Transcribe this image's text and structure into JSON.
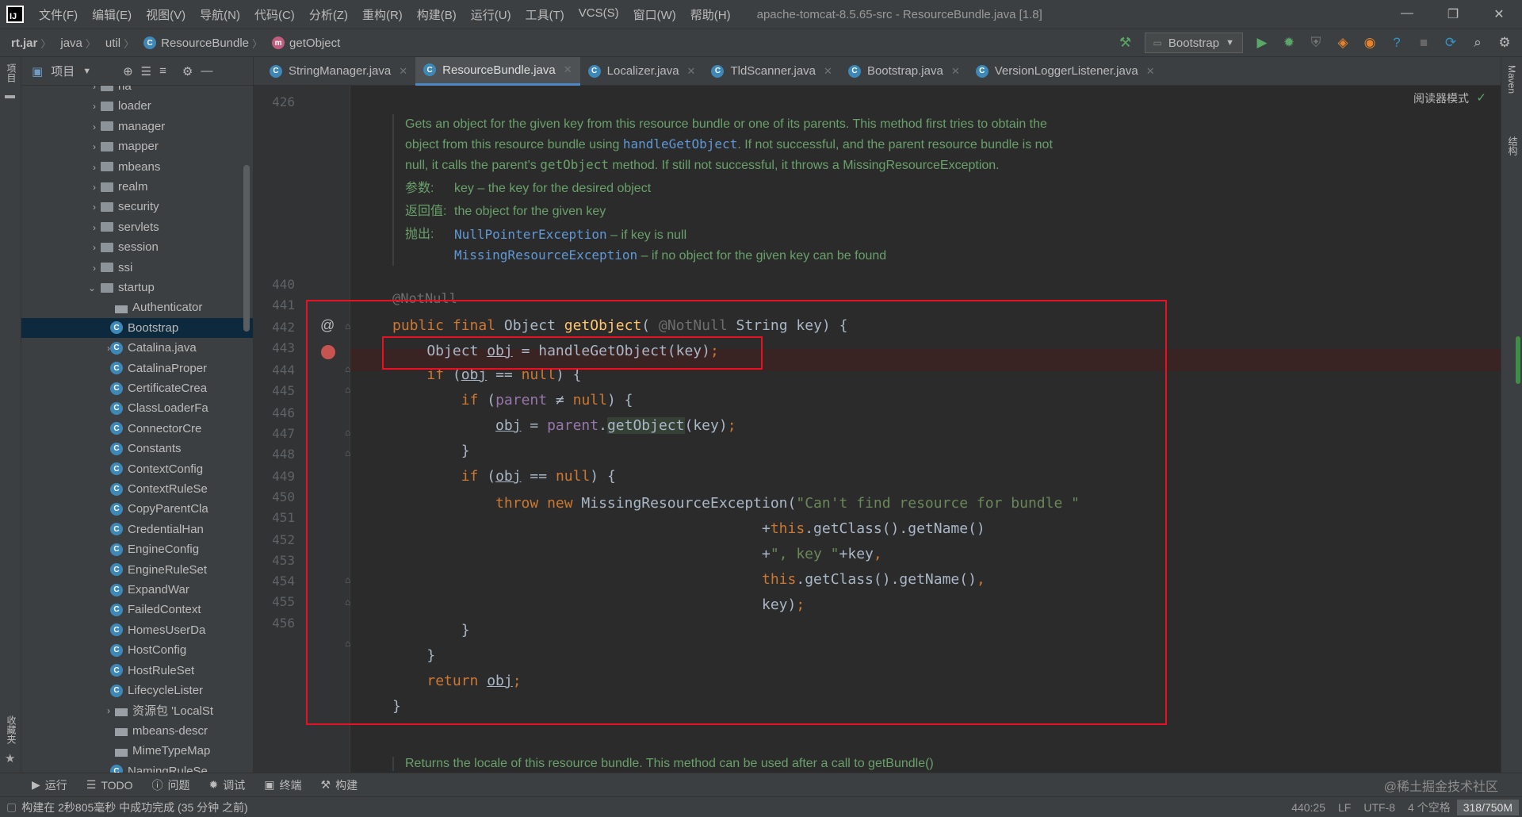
{
  "menubar": {
    "items": [
      "文件(F)",
      "编辑(E)",
      "视图(V)",
      "导航(N)",
      "代码(C)",
      "分析(Z)",
      "重构(R)",
      "构建(B)",
      "运行(U)",
      "工具(T)",
      "VCS(S)",
      "窗口(W)",
      "帮助(H)"
    ],
    "title": "apache-tomcat-8.5.65-src - ResourceBundle.java [1.8]"
  },
  "navbar": {
    "crumbs": [
      "rt.jar",
      "java",
      "util",
      "ResourceBundle",
      "getObject"
    ],
    "run_config": "Bootstrap"
  },
  "project_header": {
    "label": "项目"
  },
  "tabs": [
    {
      "label": "StringManager.java",
      "active": false
    },
    {
      "label": "ResourceBundle.java",
      "active": true
    },
    {
      "label": "Localizer.java",
      "active": false
    },
    {
      "label": "TldScanner.java",
      "active": false
    },
    {
      "label": "Bootstrap.java",
      "active": false
    },
    {
      "label": "VersionLoggerListener.java",
      "active": false
    }
  ],
  "left_strip": {
    "project": "项目",
    "favorites": "收藏夹"
  },
  "right_strip": {
    "maven": "Maven",
    "structure": "结构"
  },
  "tree": [
    {
      "label": "na",
      "type": "folder",
      "indent": 1,
      "arrow": "›"
    },
    {
      "label": "loader",
      "type": "folder",
      "indent": 1,
      "arrow": "›"
    },
    {
      "label": "manager",
      "type": "folder",
      "indent": 1,
      "arrow": "›"
    },
    {
      "label": "mapper",
      "type": "folder",
      "indent": 1,
      "arrow": "›"
    },
    {
      "label": "mbeans",
      "type": "folder",
      "indent": 1,
      "arrow": "›"
    },
    {
      "label": "realm",
      "type": "folder",
      "indent": 1,
      "arrow": "›"
    },
    {
      "label": "security",
      "type": "folder",
      "indent": 1,
      "arrow": "›"
    },
    {
      "label": "servlets",
      "type": "folder",
      "indent": 1,
      "arrow": "›"
    },
    {
      "label": "session",
      "type": "folder",
      "indent": 1,
      "arrow": "›"
    },
    {
      "label": "ssi",
      "type": "folder",
      "indent": 1,
      "arrow": "›"
    },
    {
      "label": "startup",
      "type": "folder",
      "indent": 1,
      "arrow": "⌄"
    },
    {
      "label": "Authenticator",
      "type": "file",
      "indent": 2,
      "arrow": ""
    },
    {
      "label": "Bootstrap",
      "type": "class",
      "indent": 2,
      "arrow": "",
      "selected": true
    },
    {
      "label": "Catalina.java",
      "type": "class",
      "indent": 2,
      "arrow": "›"
    },
    {
      "label": "CatalinaProper",
      "type": "class",
      "indent": 2,
      "arrow": ""
    },
    {
      "label": "CertificateCrea",
      "type": "class",
      "indent": 2,
      "arrow": ""
    },
    {
      "label": "ClassLoaderFa",
      "type": "class",
      "indent": 2,
      "arrow": ""
    },
    {
      "label": "ConnectorCre",
      "type": "class",
      "indent": 2,
      "arrow": ""
    },
    {
      "label": "Constants",
      "type": "class",
      "indent": 2,
      "arrow": ""
    },
    {
      "label": "ContextConfig",
      "type": "class",
      "indent": 2,
      "arrow": ""
    },
    {
      "label": "ContextRuleSe",
      "type": "class",
      "indent": 2,
      "arrow": ""
    },
    {
      "label": "CopyParentCla",
      "type": "class",
      "indent": 2,
      "arrow": ""
    },
    {
      "label": "CredentialHan",
      "type": "class",
      "indent": 2,
      "arrow": ""
    },
    {
      "label": "EngineConfig",
      "type": "class",
      "indent": 2,
      "arrow": ""
    },
    {
      "label": "EngineRuleSet",
      "type": "class",
      "indent": 2,
      "arrow": ""
    },
    {
      "label": "ExpandWar",
      "type": "class",
      "indent": 2,
      "arrow": ""
    },
    {
      "label": "FailedContext",
      "type": "class",
      "indent": 2,
      "arrow": ""
    },
    {
      "label": "HomesUserDa",
      "type": "class",
      "indent": 2,
      "arrow": ""
    },
    {
      "label": "HostConfig",
      "type": "class",
      "indent": 2,
      "arrow": ""
    },
    {
      "label": "HostRuleSet",
      "type": "class",
      "indent": 2,
      "arrow": ""
    },
    {
      "label": "LifecycleLister",
      "type": "class",
      "indent": 2,
      "arrow": ""
    },
    {
      "label": "资源包 'LocalSt",
      "type": "file",
      "indent": 2,
      "arrow": "›"
    },
    {
      "label": "mbeans-descr",
      "type": "file",
      "indent": 2,
      "arrow": ""
    },
    {
      "label": "MimeTypeMap",
      "type": "file",
      "indent": 2,
      "arrow": ""
    },
    {
      "label": "NamingRuleSe",
      "type": "class",
      "indent": 2,
      "arrow": ""
    }
  ],
  "editor": {
    "reader_mode": "阅读器模式",
    "doc": {
      "p1": "Gets an object for the given key from this resource bundle or one of its parents. This method first tries to obtain the object from this resource bundle using",
      "p1_link": "handleGetObject",
      "p1b": ". If not successful, and the parent resource bundle is not null, it calls the parent's",
      "p1_code": "getObject",
      "p1c": "method. If still not successful, it throws a MissingResourceException.",
      "param_label": "参数:",
      "param_text": "key – the key for the desired object",
      "return_label": "返回值:",
      "return_text": "the object for the given key",
      "throws_label": "抛出:",
      "throws_1_name": "NullPointerException",
      "throws_1_text": " – if key is null",
      "throws_2_name": "MissingResourceException",
      "throws_2_text": " – if no object for the given key can be found"
    },
    "annotation_line": "@NotNull",
    "line_numbers": [
      "426",
      "440",
      "441",
      "442",
      "443",
      "444",
      "445",
      "446",
      "447",
      "448",
      "449",
      "450",
      "451",
      "452",
      "453",
      "454",
      "455",
      "456"
    ],
    "gutter_at": "@",
    "bottom_doc": "Returns the locale of this resource bundle. This method can be used after a call to getBundle()"
  },
  "toolwindows": [
    "运行",
    "TODO",
    "问题",
    "调试",
    "终端",
    "构建"
  ],
  "status": {
    "message": "构建在 2秒805毫秒 中成功完成 (35 分钟 之前)",
    "position": "440:25",
    "line_sep": "LF",
    "encoding": "UTF-8",
    "indent": "4 个空格",
    "memory": "318/750M"
  },
  "watermark": "@稀土掘金技术社区"
}
